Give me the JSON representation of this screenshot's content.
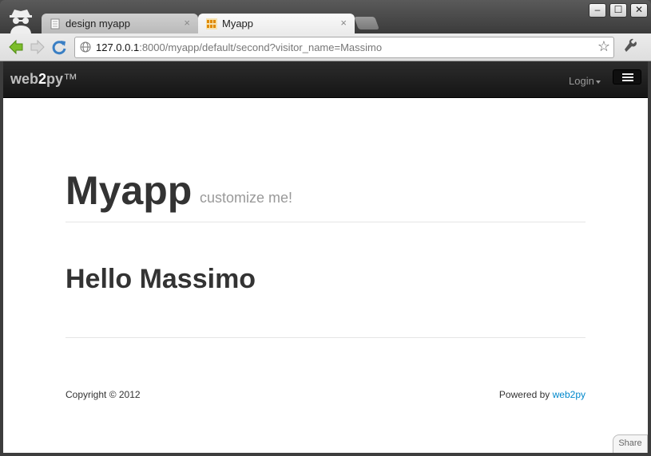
{
  "browser": {
    "tabs": [
      {
        "label": "design myapp"
      },
      {
        "label": "Myapp"
      }
    ],
    "tab_close_glyph": "×",
    "window_controls": {
      "minimize": "–",
      "maximize": "☐",
      "close": "✕"
    },
    "url": {
      "host": "127.0.0.1",
      "rest": ":8000/myapp/default/second?visitor_name=Massimo"
    },
    "icons": [
      "incognito-icon",
      "back-icon",
      "forward-icon",
      "reload-icon",
      "globe-icon",
      "bookmark-star-icon",
      "wrench-icon"
    ],
    "bookmark_glyph": "☆"
  },
  "navbar": {
    "brand": {
      "part1": "web",
      "part2": "2",
      "part3": "py",
      "tm": "™"
    },
    "login_label": "Login"
  },
  "main": {
    "title": "Myapp",
    "subtitle": "customize me!",
    "greeting": "Hello Massimo"
  },
  "footer": {
    "copyright": "Copyright © 2012",
    "powered_prefix": "Powered by ",
    "powered_link": "web2py"
  },
  "share_label": "Share",
  "colors": {
    "link": "#0088cc",
    "navbar": "#1b1b1b",
    "heading": "#333333",
    "subtitle": "#999999"
  }
}
